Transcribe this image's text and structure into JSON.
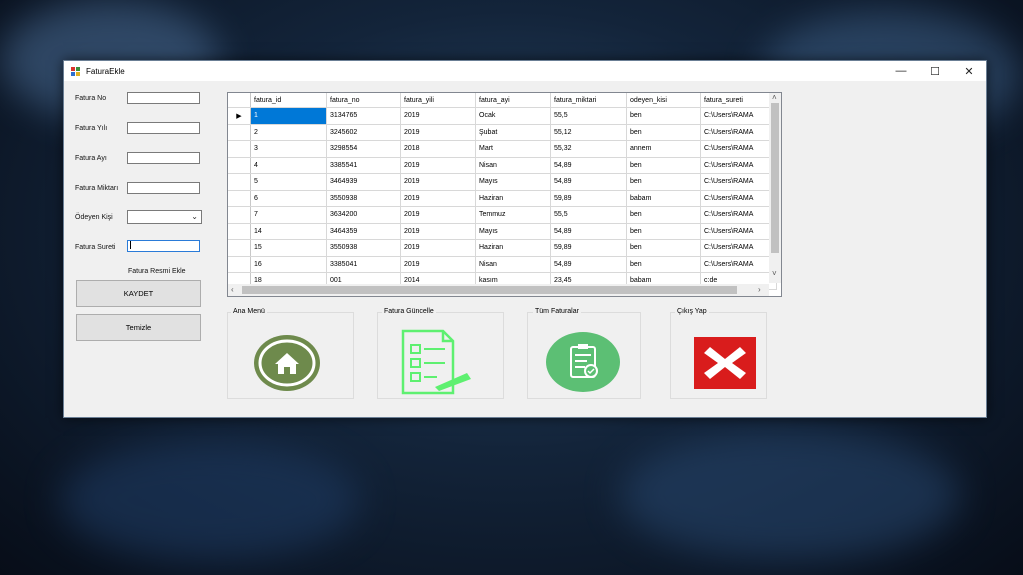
{
  "window": {
    "title": "FaturaEkle",
    "controls": {
      "minimize": "—",
      "maximize": "☐",
      "close": "✕"
    }
  },
  "form": {
    "fields": [
      {
        "label": "Fatura No",
        "value": ""
      },
      {
        "label": "Fatura Yılı",
        "value": ""
      },
      {
        "label": "Fatura Ayı",
        "value": ""
      },
      {
        "label": "Fatura Miktarı",
        "value": ""
      },
      {
        "label": "Ödeyen Kişi",
        "value": ""
      },
      {
        "label": "Fatura Sureti",
        "value": ""
      }
    ],
    "image_label": "Fatura Resmi Ekle",
    "save_button": "KAYDET",
    "clear_button": "Temizle"
  },
  "grid": {
    "columns": [
      "fatura_id",
      "fatura_no",
      "fatura_yili",
      "fatura_ayi",
      "fatura_miktari",
      "odeyen_kisi",
      "fatura_sureti"
    ],
    "rows": [
      [
        "1",
        "3134765",
        "2019",
        "Ocak",
        "55,5",
        "ben",
        "C:\\Users\\RAMA"
      ],
      [
        "2",
        "3245602",
        "2019",
        "Şubat",
        "55,12",
        "ben",
        "C:\\Users\\RAMA"
      ],
      [
        "3",
        "3298554",
        "2018",
        "Mart",
        "55,32",
        "annem",
        "C:\\Users\\RAMA"
      ],
      [
        "4",
        "3385541",
        "2019",
        "Nisan",
        "54,89",
        "ben",
        "C:\\Users\\RAMA"
      ],
      [
        "5",
        "3464939",
        "2019",
        "Mayıs",
        "54,89",
        "ben",
        "C:\\Users\\RAMA"
      ],
      [
        "6",
        "3550938",
        "2019",
        "Haziran",
        "59,89",
        "babam",
        "C:\\Users\\RAMA"
      ],
      [
        "7",
        "3634200",
        "2019",
        "Temmuz",
        "55,5",
        "ben",
        "C:\\Users\\RAMA"
      ],
      [
        "14",
        "3464359",
        "2019",
        "Mayıs",
        "54,89",
        "ben",
        "C:\\Users\\RAMA"
      ],
      [
        "15",
        "3550938",
        "2019",
        "Haziran",
        "59,89",
        "ben",
        "C:\\Users\\RAMA"
      ],
      [
        "16",
        "3385041",
        "2019",
        "Nisan",
        "54,89",
        "ben",
        "C:\\Users\\RAMA"
      ],
      [
        "18",
        "001",
        "2014",
        "kasım",
        "23,45",
        "babam",
        "c:de"
      ]
    ],
    "current_row_marker": "▶"
  },
  "nav": {
    "home": "Ana Menü",
    "update": "Fatura Güncelle",
    "all": "Tüm Faturalar",
    "exit": "Çıkış Yap"
  },
  "colors": {
    "home_green": "#6e8a4c",
    "update_green": "#5ef070",
    "all_green": "#5cbf74",
    "exit_red": "#d91c1c",
    "selection": "#0078d7"
  },
  "icons": {
    "home": "home-icon",
    "update": "document-checklist-icon",
    "all": "clipboard-icon",
    "exit": "close-x-icon"
  }
}
